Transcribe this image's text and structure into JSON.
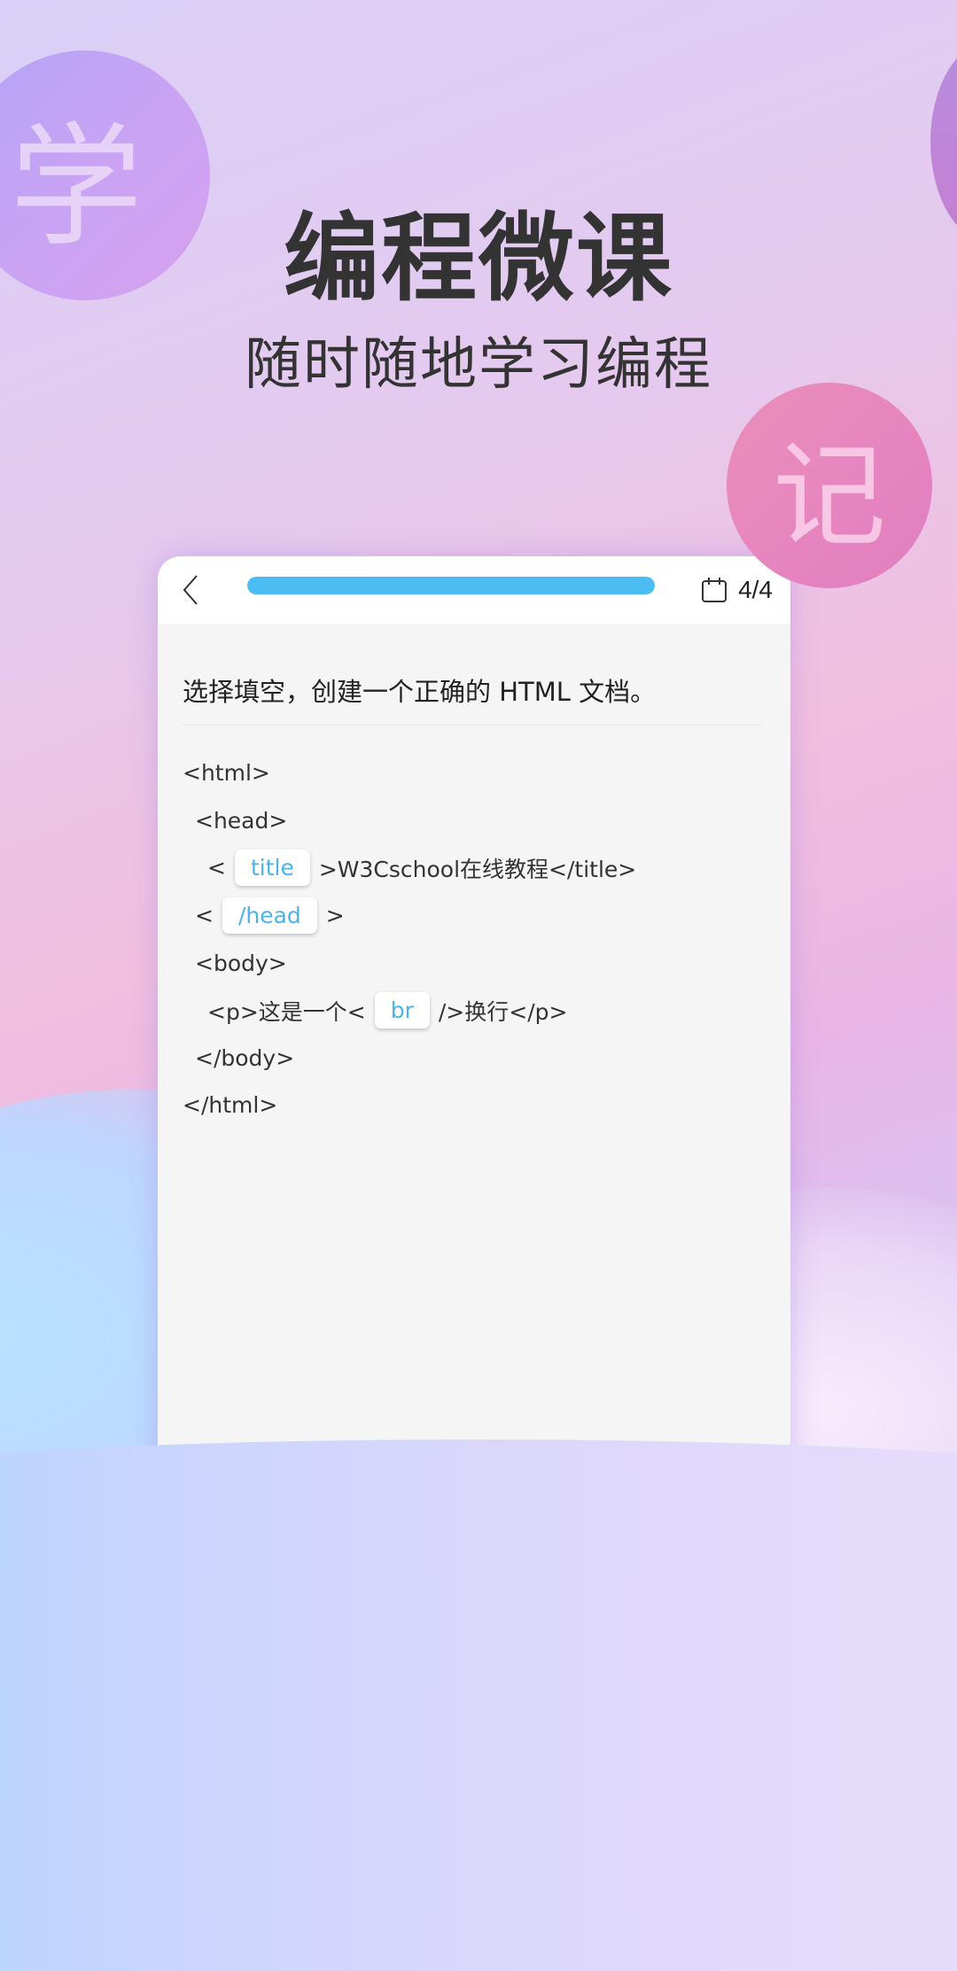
{
  "promo": {
    "headline": "编程微课",
    "subheadline": "随时随地学习编程",
    "badge_left": "学",
    "badge_right": "记"
  },
  "quiz": {
    "progress_fraction": 1.0,
    "counter": "4/4",
    "question": "选择填空，创建一个正确的 HTML 文档。",
    "code_lines": [
      {
        "indent": 1,
        "before": "<html>",
        "chip": null,
        "after": ""
      },
      {
        "indent": 2,
        "before": "<head>",
        "chip": null,
        "after": ""
      },
      {
        "indent": 3,
        "before": "<",
        "chip": "title",
        "after": ">W3Cschool在线教程</title>"
      },
      {
        "indent": 2,
        "before": "<",
        "chip": "/head",
        "after": ">"
      },
      {
        "indent": 2,
        "before": "<body>",
        "chip": null,
        "after": ""
      },
      {
        "indent": 3,
        "before": "<p>这是一个<",
        "chip": "br",
        "after": "/>换行</p>"
      },
      {
        "indent": 2,
        "before": "</body>",
        "chip": null,
        "after": ""
      },
      {
        "indent": 1,
        "before": "</html>",
        "chip": null,
        "after": ""
      }
    ]
  },
  "colors": {
    "accent": "#4bbdf3",
    "chip_text": "#4bb3ea",
    "text": "#333333"
  },
  "icons": {
    "back": "chevron-left-icon",
    "counter": "calendar-icon"
  }
}
